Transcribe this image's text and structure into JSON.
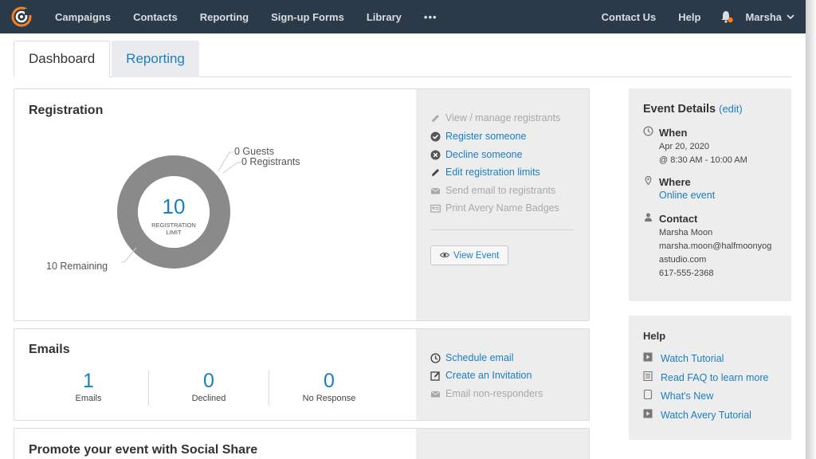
{
  "nav": {
    "items": [
      "Campaigns",
      "Contacts",
      "Reporting",
      "Sign-up Forms",
      "Library"
    ],
    "more": "•••",
    "contact_us": "Contact Us",
    "help": "Help",
    "user": "Marsha",
    "accent": "#f5821f"
  },
  "tabs": {
    "dashboard": "Dashboard",
    "reporting": "Reporting"
  },
  "registration": {
    "title": "Registration",
    "limit_value": "10",
    "limit_label_1": "REGISTRATION",
    "limit_label_2": "LIMIT",
    "guests": "0 Guests",
    "registrants": "0 Registrants",
    "remaining": "10 Remaining",
    "actions": [
      {
        "label": "View / manage registrants",
        "enabled": false,
        "icon": "pencil-icon"
      },
      {
        "label": "Register someone",
        "enabled": true,
        "icon": "check-circle-icon"
      },
      {
        "label": "Decline someone",
        "enabled": true,
        "icon": "x-circle-icon"
      },
      {
        "label": "Edit registration limits",
        "enabled": true,
        "icon": "pencil-icon"
      },
      {
        "label": "Send email to registrants",
        "enabled": false,
        "icon": "envelope-icon"
      },
      {
        "label": "Print Avery Name Badges",
        "enabled": false,
        "icon": "badge-icon"
      }
    ],
    "view_event": "View Event"
  },
  "emails": {
    "title": "Emails",
    "stats": [
      {
        "value": "1",
        "label": "Emails"
      },
      {
        "value": "0",
        "label": "Declined"
      },
      {
        "value": "0",
        "label": "No Response"
      }
    ],
    "actions": [
      {
        "label": "Schedule email",
        "enabled": true,
        "icon": "clock-icon"
      },
      {
        "label": "Create an Invitation",
        "enabled": true,
        "icon": "edit-box-icon"
      },
      {
        "label": "Email non-responders",
        "enabled": false,
        "icon": "envelope-icon"
      }
    ]
  },
  "social": {
    "title": "Promote your event with Social Share"
  },
  "event_details": {
    "title": "Event Details",
    "edit": "(edit)",
    "when_label": "When",
    "when_date": "Apr 20, 2020",
    "when_time": "@ 8:30 AM - 10:00 AM",
    "where_label": "Where",
    "where_value": "Online event",
    "contact_label": "Contact",
    "contact_name": "Marsha Moon",
    "contact_email_1": "marsha.moon@halfmoonyog",
    "contact_email_2": "astudio.com",
    "contact_phone": "617-555-2368"
  },
  "help": {
    "title": "Help",
    "items": [
      {
        "label": "Watch Tutorial",
        "icon": "video-icon"
      },
      {
        "label": "Read FAQ to learn more",
        "icon": "document-icon"
      },
      {
        "label": "What's New",
        "icon": "page-icon"
      },
      {
        "label": "Watch Avery Tutorial",
        "icon": "video-icon"
      }
    ]
  }
}
